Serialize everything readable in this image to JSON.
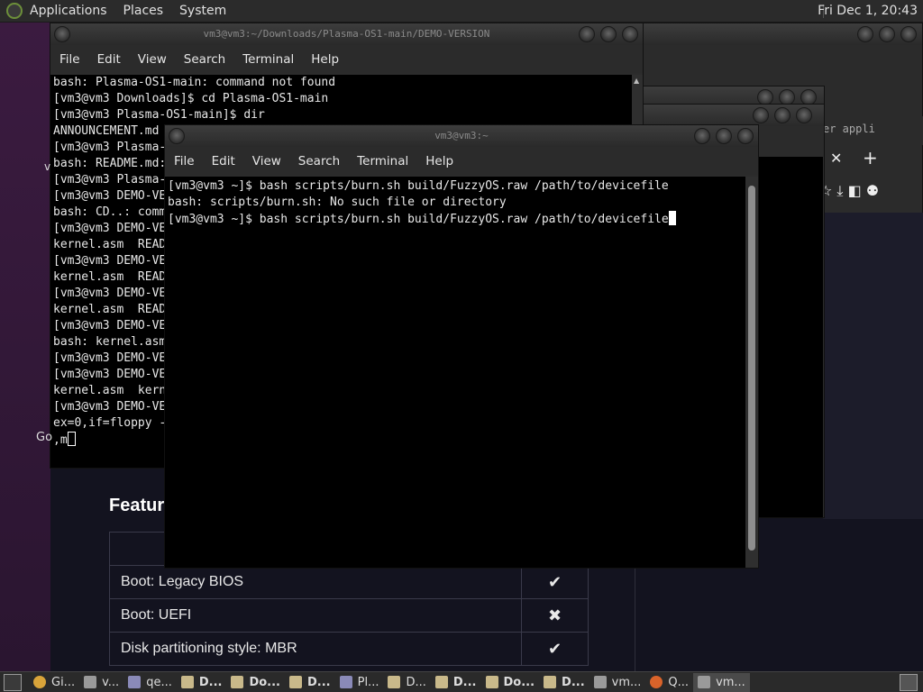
{
  "panel": {
    "menus": [
      "Applications",
      "Places",
      "System"
    ],
    "clock": "Fri Dec 1, 20:43"
  },
  "background": {
    "feature_heading": "Featur",
    "go_label": "Go",
    "v_label": "v",
    "features": [
      {
        "label": "Boot: Legacy BIOS",
        "mark": "✔"
      },
      {
        "label": "Boot: UEFI",
        "mark": "✖"
      },
      {
        "label": "Disk partitioning style: MBR",
        "mark": "✔"
      }
    ],
    "browser_tab_title": "er appli",
    "browser_close": "✕",
    "browser_new_tab": "+",
    "browser_tools": "☆  ⤓  ◧  ⚉"
  },
  "left_terminal": {
    "title": "vm3@vm3:~/Downloads/Plasma-OS1-main/DEMO-VERSION",
    "menu": [
      "File",
      "Edit",
      "View",
      "Search",
      "Terminal",
      "Help"
    ],
    "lines": [
      "bash: Plasma-OS1-main: command not found",
      "[vm3@vm3 Downloads]$ cd Plasma-OS1-main",
      "[vm3@vm3 Plasma-OS1-main]$ dir",
      "ANNOUNCEMENT.md",
      "[vm3@vm3 Plasma-",
      "bash: README.md:",
      "[vm3@vm3 Plasma-",
      "[vm3@vm3 DEMO-VE",
      "bash: CD..: comm",
      "[vm3@vm3 DEMO-VE",
      "kernel.asm  READ",
      "[vm3@vm3 DEMO-VE",
      "kernel.asm  READ",
      "[vm3@vm3 DEMO-VE",
      "kernel.asm  READ",
      "[vm3@vm3 DEMO-VE",
      "bash: kernel.asm",
      "[vm3@vm3 DEMO-VE",
      "[vm3@vm3 DEMO-VE",
      "kernel.asm  kern",
      "[vm3@vm3 DEMO-VE",
      "ex=0,if=floppy -",
      ",m"
    ]
  },
  "front_terminal": {
    "title": "vm3@vm3:~",
    "menu": [
      "File",
      "Edit",
      "View",
      "Search",
      "Terminal",
      "Help"
    ],
    "lines": [
      "[vm3@vm3 ~]$ bash scripts/burn.sh build/FuzzyOS.raw /path/to/devicefile",
      "bash: scripts/burn.sh: No such file or directory",
      "[vm3@vm3 ~]$ bash scripts/burn.sh build/FuzzyOS.raw /path/to/devicefile"
    ]
  },
  "taskbar": {
    "items": [
      {
        "label": "Gi...",
        "icon": "chrome-icon",
        "bold": false
      },
      {
        "label": "v...",
        "icon": "terminal-icon",
        "bold": false
      },
      {
        "label": "qe...",
        "icon": "qemu-icon",
        "bold": false
      },
      {
        "label": "D...",
        "icon": "folder-icon",
        "bold": true
      },
      {
        "label": "Do...",
        "icon": "folder-icon",
        "bold": true
      },
      {
        "label": "D...",
        "icon": "folder-icon",
        "bold": true
      },
      {
        "label": "Pl...",
        "icon": "qemu-icon",
        "bold": false
      },
      {
        "label": "D...",
        "icon": "folder-icon",
        "bold": false
      },
      {
        "label": "D...",
        "icon": "folder-icon",
        "bold": true
      },
      {
        "label": "Do...",
        "icon": "folder-icon",
        "bold": true
      },
      {
        "label": "D...",
        "icon": "folder-icon",
        "bold": true
      },
      {
        "label": "vm...",
        "icon": "terminal-icon",
        "bold": false
      },
      {
        "label": "Q...",
        "icon": "firefox-icon",
        "bold": false
      },
      {
        "label": "vm...",
        "icon": "terminal-icon",
        "bold": false,
        "active": true
      }
    ]
  }
}
